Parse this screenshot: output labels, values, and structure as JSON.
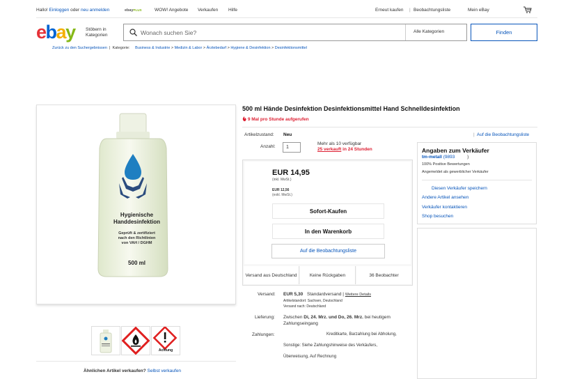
{
  "topbar": {
    "greeting": "Hallo!",
    "login": "Einloggen",
    "or": "oder",
    "register": "neu anmelden",
    "ebayplus_prefix": "ebay",
    "ebayplus_suffix": "PLUS",
    "wow": "WOW! Angebote",
    "sell": "Verkaufen",
    "help": "Hilfe",
    "rebuy": "Erneut kaufen",
    "watchlist": "Beobachtungsliste",
    "myebay": "Mein eBay"
  },
  "header": {
    "browse_line1": "Stöbern in",
    "browse_line2": "Kategorien",
    "search_placeholder": "Wonach suchen Sie?",
    "category_select": "Alle Kategorien",
    "find_button": "Finden"
  },
  "breadcrumb": {
    "back": "Zurück zu den Suchergebnissen",
    "category_label": "Kategorie:",
    "items": [
      "Business & Industrie",
      "Medizin & Labor",
      "Ärztebedarf",
      "Hygiene & Desinfektion",
      "Desinfektionsmittel"
    ],
    "separator": ">"
  },
  "product": {
    "title": "500 ml Hände Desinfektion Desinfektionsmittel Hand Schnelldesinfektion",
    "hot_text": "9 Mal pro Stunde aufgerufen",
    "label_lines": [
      "Hygienische",
      "Handdesinfektion"
    ],
    "label_small": [
      "Geprüft & zertifiziert",
      "nach den Richtlinien",
      "von VAH / DGHM"
    ],
    "volume": "500 ml",
    "thumb2_text": "",
    "thumb3_text": "Achtung"
  },
  "details": {
    "condition_label": "Artikelzustand:",
    "condition_value": "Neu",
    "watch_link": "Auf die Beobachtungsliste",
    "quantity_label": "Anzahl:",
    "quantity_value": "1",
    "available": "Mehr als 10 verfügbar",
    "sold_link": "25 verkauft",
    "sold_suffix": "in 24 Stunden"
  },
  "buybox": {
    "price": "EUR 14,95",
    "incl_vat": "(inkl. MwSt.)",
    "net_price": "EUR 12,56",
    "excl_vat": "(exkl. MwSt.)",
    "buy_now": "Sofort-Kaufen",
    "add_to_cart": "In den Warenkorb",
    "watch": "Auf die Beobachtungsliste",
    "feat_shipping": "Versand aus Deutschland",
    "feat_returns": "Keine Rückgaben",
    "feat_watchers": "36 Beobachter"
  },
  "seller": {
    "heading": "Angaben zum Verkäufer",
    "name": "tm-metall",
    "score": "(9893",
    "score_close": ")",
    "positive": "100% Positive Bewertungen",
    "business": "Angemeldet als gewerblicher Verkäufer",
    "save_seller": "Diesen Verkäufer speichern",
    "other_items": "Andere Artikel ansehen",
    "contact": "Verkäufer kontaktieren",
    "shop": "Shop besuchen"
  },
  "shipping": {
    "label": "Versand:",
    "price": "EUR 5,30",
    "method": "Standardversand |",
    "more": "Weitere Details",
    "location": "Artikelstandort: Sachsen, Deutschland",
    "ships_to": "Versand nach: Deutschland",
    "delivery_label": "Lieferung:",
    "delivery_prefix": "Zwischen",
    "delivery_dates": "Di, 24. Mrz. und Do, 26. Mrz.",
    "delivery_suffix": "bei heutigem",
    "delivery_line2": "Zahlungseingang",
    "payment_label": "Zahlungen:",
    "payment_line1": "Kreditkarte, Barzahlung bei Abholung,",
    "payment_line2": "Sonstige: Siehe Zahlungshinweise des Verkäufers,",
    "payment_line3": "Überweisung, Auf Rechnung"
  },
  "sell_similar": {
    "question": "Ähnlichen Artikel verkaufen?",
    "link": "Selbst verkaufen"
  },
  "colors": {
    "ebay_red": "#e53238",
    "ebay_blue": "#0064d2",
    "ebay_yellow": "#f5af02",
    "ebay_green": "#86b817",
    "link": "#0654ba",
    "hot": "#dd1e31"
  }
}
